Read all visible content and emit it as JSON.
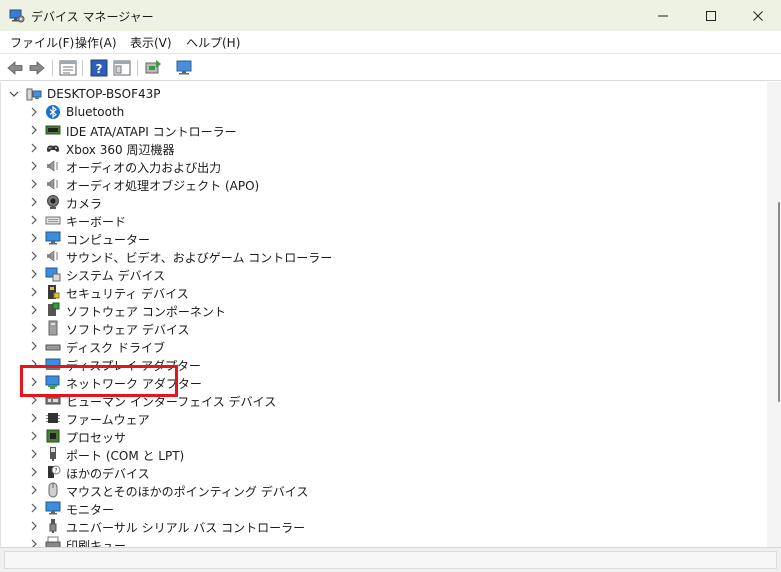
{
  "window": {
    "title": "デバイス マネージャー",
    "app_icon": "device-manager-icon",
    "controls": [
      "minimize-icon",
      "maximize-icon",
      "close-icon"
    ]
  },
  "menu": {
    "items": [
      {
        "label": "ファイル(F)"
      },
      {
        "label": "操作(A)"
      },
      {
        "label": "表示(V)"
      },
      {
        "label": "ヘルプ(H)"
      }
    ]
  },
  "toolbar": {
    "buttons": [
      "back-arrow-icon",
      "forward-arrow-icon",
      "properties-icon",
      "help-icon",
      "view-icon",
      "update-driver-icon",
      "scan-hardware-icon"
    ]
  },
  "tree": {
    "root": {
      "label": "DESKTOP-BSOF43P",
      "icon": "computer-icon",
      "expanded": true
    },
    "items": [
      {
        "label": "Bluetooth",
        "icon": "bluetooth-icon"
      },
      {
        "label": "IDE ATA/ATAPI コントローラー",
        "icon": "ide-controller-icon"
      },
      {
        "label": "Xbox 360 周辺機器",
        "icon": "gamepad-icon"
      },
      {
        "label": "オーディオの入力および出力",
        "icon": "speaker-icon"
      },
      {
        "label": "オーディオ処理オブジェクト (APO)",
        "icon": "speaker-icon"
      },
      {
        "label": "カメラ",
        "icon": "webcam-icon"
      },
      {
        "label": "キーボード",
        "icon": "keyboard-icon"
      },
      {
        "label": "コンピューター",
        "icon": "monitor-icon"
      },
      {
        "label": "サウンド、ビデオ、およびゲーム コントローラー",
        "icon": "speaker-icon"
      },
      {
        "label": "システム デバイス",
        "icon": "system-devices-icon"
      },
      {
        "label": "セキュリティ デバイス",
        "icon": "security-device-icon"
      },
      {
        "label": "ソフトウェア コンポーネント",
        "icon": "software-component-icon"
      },
      {
        "label": "ソフトウェア デバイス",
        "icon": "software-device-icon"
      },
      {
        "label": "ディスク ドライブ",
        "icon": "disk-drive-icon"
      },
      {
        "label": "ディスプレイ アダプター",
        "icon": "display-adapter-icon"
      },
      {
        "label": "ネットワーク アダプター",
        "icon": "network-adapter-icon"
      },
      {
        "label": "ヒューマン インターフェイス デバイス",
        "icon": "hid-icon"
      },
      {
        "label": "ファームウェア",
        "icon": "chip-icon"
      },
      {
        "label": "プロセッサ",
        "icon": "processor-icon"
      },
      {
        "label": "ポート (COM と LPT)",
        "icon": "port-icon"
      },
      {
        "label": "ほかのデバイス",
        "icon": "unknown-device-icon"
      },
      {
        "label": "マウスとそのほかのポインティング デバイス",
        "icon": "mouse-icon"
      },
      {
        "label": "モニター",
        "icon": "monitor-icon"
      },
      {
        "label": "ユニバーサル シリアル バス コントローラー",
        "icon": "usb-icon"
      },
      {
        "label": "印刷キュー",
        "icon": "printer-icon"
      }
    ]
  },
  "highlight": {
    "target": "ネットワーク アダプター",
    "color": "#e8141c"
  },
  "colors": {
    "titlebar": "#eef2e3",
    "accent": "#e8141c"
  }
}
